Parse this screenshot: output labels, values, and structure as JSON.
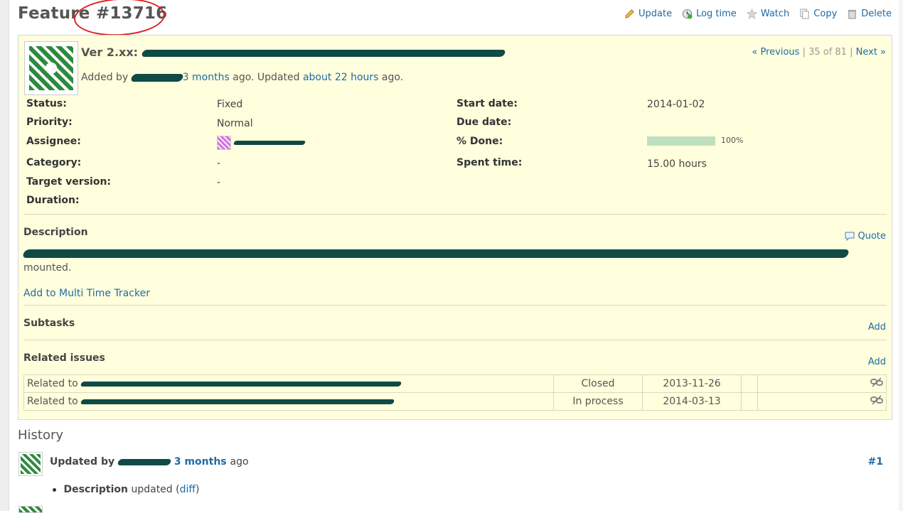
{
  "header": {
    "tracker": "Feature",
    "number": "#13716"
  },
  "toolbar": {
    "update": "Update",
    "log_time": "Log time",
    "watch": "Watch",
    "copy": "Copy",
    "delete": "Delete"
  },
  "issue": {
    "subject_prefix": "Ver 2.xx:",
    "added_by": "Added by",
    "created_ago": "3 months",
    "ago_updated": "ago. Updated",
    "updated_ago": "about 22 hours",
    "ago_end": "ago.",
    "prev": "« Previous",
    "position": "35 of 81",
    "next": "Next »"
  },
  "attributes": {
    "status_label": "Status:",
    "status": "Fixed",
    "priority_label": "Priority:",
    "priority": "Normal",
    "assignee_label": "Assignee:",
    "category_label": "Category:",
    "category": "-",
    "target_label": "Target version:",
    "target": "-",
    "duration_label": "Duration:",
    "start_label": "Start date:",
    "start": "2014-01-02",
    "due_label": "Due date:",
    "done_label": "% Done:",
    "done_pct": "100%",
    "done_value": 1.0,
    "spent_label": "Spent time:",
    "spent": "15.00 hours"
  },
  "description": {
    "title": "Description",
    "quote": "Quote",
    "text_end": "mounted.",
    "tracker_link": "Add to Multi Time Tracker"
  },
  "subtasks": {
    "title": "Subtasks",
    "add": "Add"
  },
  "related": {
    "title": "Related issues",
    "add": "Add",
    "rows": [
      {
        "prefix": "Related to",
        "status": "Closed",
        "date": "2013-11-26"
      },
      {
        "prefix": "Related to",
        "status": "In process",
        "date": "2014-03-13"
      }
    ]
  },
  "history": {
    "title": "History",
    "updated_by": "Updated by",
    "ago_link": "3 months",
    "ago": "ago",
    "num": "#1",
    "field": "Description",
    "updated": "updated",
    "diff": "diff"
  },
  "colors": {
    "link": "#1f6aa5",
    "issue_bg": "#ffffdd",
    "progress": "#bfe0bf",
    "annotation": "#e02020"
  }
}
